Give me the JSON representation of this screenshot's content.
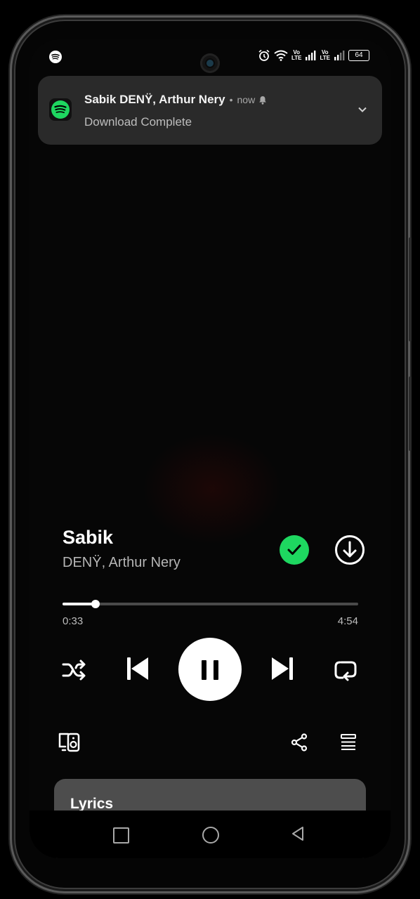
{
  "status_bar": {
    "app_icon": "spotify-icon",
    "icons": [
      "alarm-icon",
      "wifi-icon",
      "volte-icon",
      "signal-icon",
      "volte-icon",
      "signal-icon"
    ],
    "volte_label_top": "Vo",
    "volte_label_bottom": "LTE",
    "battery_level": "64"
  },
  "notification": {
    "app_icon": "spotify-icon",
    "title": "Sabik DENŸ, Arthur Nery",
    "separator": "•",
    "time": "now",
    "subtitle": "Download Complete",
    "expand_icon": "chevron-down-icon"
  },
  "player": {
    "song_title": "Sabik",
    "artist": "DENŸ, Arthur Nery",
    "liked": true,
    "downloaded": true,
    "elapsed": "0:33",
    "duration": "4:54",
    "progress_fraction": 0.112,
    "is_playing": true,
    "accent_color": "#1ed760"
  },
  "lyrics": {
    "title": "Lyrics"
  },
  "nav_bar": {
    "buttons": [
      "recents-button",
      "home-button",
      "back-button"
    ]
  }
}
